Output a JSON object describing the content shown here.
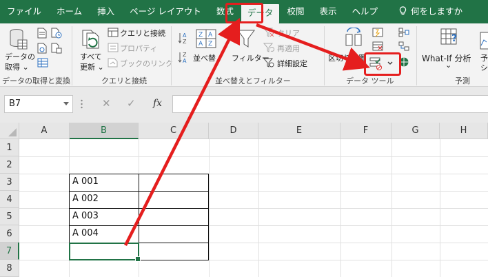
{
  "ribbon_tabs": [
    {
      "label": "ファイル"
    },
    {
      "label": "ホーム"
    },
    {
      "label": "挿入"
    },
    {
      "label": "ページ レイアウト"
    },
    {
      "label": "数式"
    },
    {
      "label": "データ"
    },
    {
      "label": "校閲"
    },
    {
      "label": "表示"
    },
    {
      "label": "ヘルプ"
    }
  ],
  "tell_me": "何をしますか",
  "groups": {
    "get_transform": {
      "get_data_line1": "データの",
      "get_data_line2": "取得 ⌄",
      "label": "データの取得と変換"
    },
    "queries": {
      "refresh_line1": "すべて",
      "refresh_line2": "更新 ⌄",
      "queries_connections": "クエリと接続",
      "properties": "プロパティ",
      "edit_links": "ブックのリンク",
      "label": "クエリと接続"
    },
    "sort_filter": {
      "sort": "並べ替",
      "filter": "フィルター",
      "clear": "クリア",
      "reapply": "再適用",
      "advanced": "詳細設定",
      "label": "並べ替えとフィルター"
    },
    "data_tools": {
      "flash_fill": "区切り位置",
      "label": "データ ツール"
    },
    "forecast": {
      "whatif_line1": "What-If 分析",
      "whatif_line2": "⌄",
      "forecast_sheet_line1": "予",
      "forecast_sheet_line2": "シ",
      "label": "予測"
    }
  },
  "formula_bar": {
    "name_box": "B7",
    "cancel": "✕",
    "enter": "✓",
    "fx": "fx",
    "value": ""
  },
  "columns": [
    "A",
    "B",
    "C",
    "D",
    "E",
    "F",
    "G",
    "H"
  ],
  "rows": [
    "1",
    "2",
    "3",
    "4",
    "5",
    "6",
    "7",
    "8"
  ],
  "cells": {
    "B3": "A 001",
    "B4": "A 002",
    "B5": "A 003",
    "B6": "A 004"
  },
  "colors": {
    "excel_green": "#217346",
    "highlight_red": "#e51e1e"
  }
}
